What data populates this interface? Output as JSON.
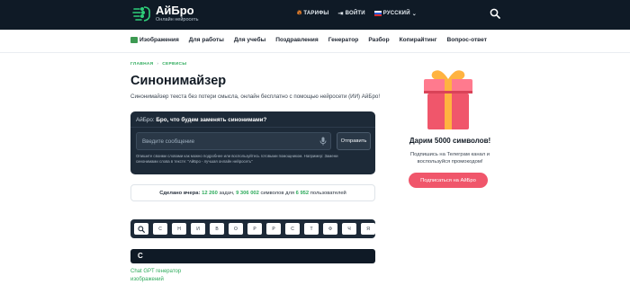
{
  "header": {
    "logo_name": "АйБро",
    "logo_subtitle": "Онлайн нейросеть",
    "links": [
      {
        "label": "ТАРИФЫ",
        "icon": "fire-icon"
      },
      {
        "label": "ВОЙТИ",
        "icon": "login-icon"
      },
      {
        "label": "РУССКИЙ",
        "icon": "russian-flag-icon"
      }
    ],
    "search_icon": "search-icon"
  },
  "nav": {
    "items": [
      "Изображения",
      "Для работы",
      "Для учебы",
      "Поздравления",
      "Генератор",
      "Разбор",
      "Копирайтинг",
      "Вопрос-ответ"
    ]
  },
  "breadcrumbs": [
    "ГЛАВНАЯ",
    "СЕРВИСЫ"
  ],
  "page": {
    "title": "Синонимайзер",
    "intro": "Синонимайзер текста без потери смысла, онлайн бесплатно с помощью нейросети (ИИ) АйБро!"
  },
  "chat": {
    "question_prefix": "АйБро: ",
    "question": "Бро, что будем заменять синонимами?",
    "input_placeholder": "Введите сообщение",
    "send_label": "Отправить",
    "hint": "Опишите своими словами как можно подробнее или воспользуйтесь готовыми помощником. Например: Замени синонимами слова в тексте: \"АйБро - лучшая онлайн нейросеть\""
  },
  "stats": {
    "prefix": "Сделано вчера:",
    "tasks": "12 260",
    "tasks_label": "задач,",
    "symbols": "9 306 002",
    "symbols_label": "символов для",
    "users": "6 952",
    "users_label": "пользователей"
  },
  "letters": [
    "С",
    "Н",
    "И",
    "В",
    "О",
    "Р",
    "Р",
    "С",
    "Т",
    "Ф",
    "Ч",
    "Я"
  ],
  "section": {
    "letter": "С"
  },
  "links": [
    "Chat GPT генератор",
    "изображений"
  ],
  "promo": {
    "title": "Дарим 5000 символов!",
    "text": "Подпишись на Телеграм канал и воспользуйся промокодом!",
    "button": "Подписаться на АйБро"
  },
  "colors": {
    "dark": "#0f1a26",
    "panel": "#1d2a38",
    "accent_green": "#2fab5c",
    "promo_pink": "#f0566b"
  }
}
